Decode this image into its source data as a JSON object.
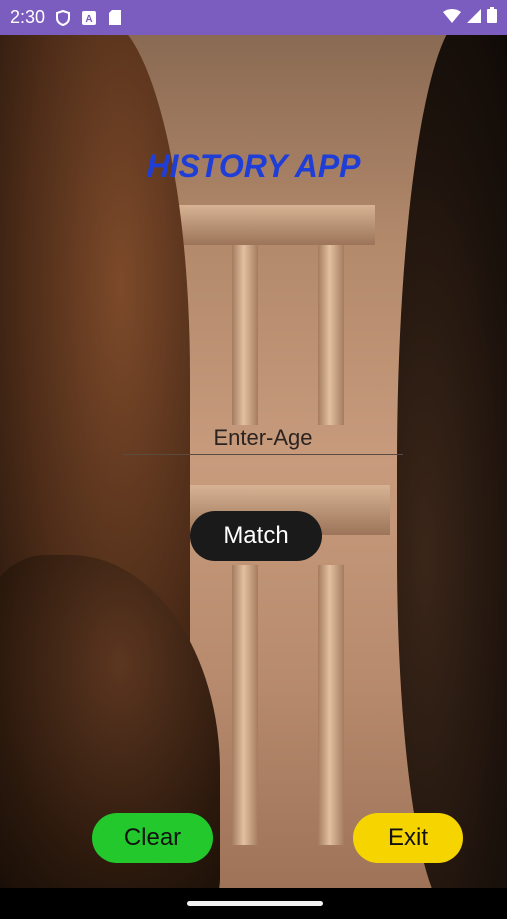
{
  "status_bar": {
    "time": "2:30",
    "left_icons": [
      "shield-icon",
      "a-icon",
      "sdcard-icon"
    ],
    "right_icons": [
      "wifi-icon",
      "signal-icon",
      "battery-icon"
    ],
    "background": "#7b5cbf"
  },
  "main": {
    "title": "HISTORY APP",
    "title_color": "#1f3ed8",
    "age_input": {
      "placeholder": "Enter-Age",
      "value": ""
    },
    "match_button": "Match",
    "clear_button": "Clear",
    "exit_button": "Exit",
    "background_image": "petra-treasury-background"
  },
  "colors": {
    "match_bg": "#1a1a1a",
    "clear_bg": "#22c82c",
    "exit_bg": "#f5d400"
  }
}
